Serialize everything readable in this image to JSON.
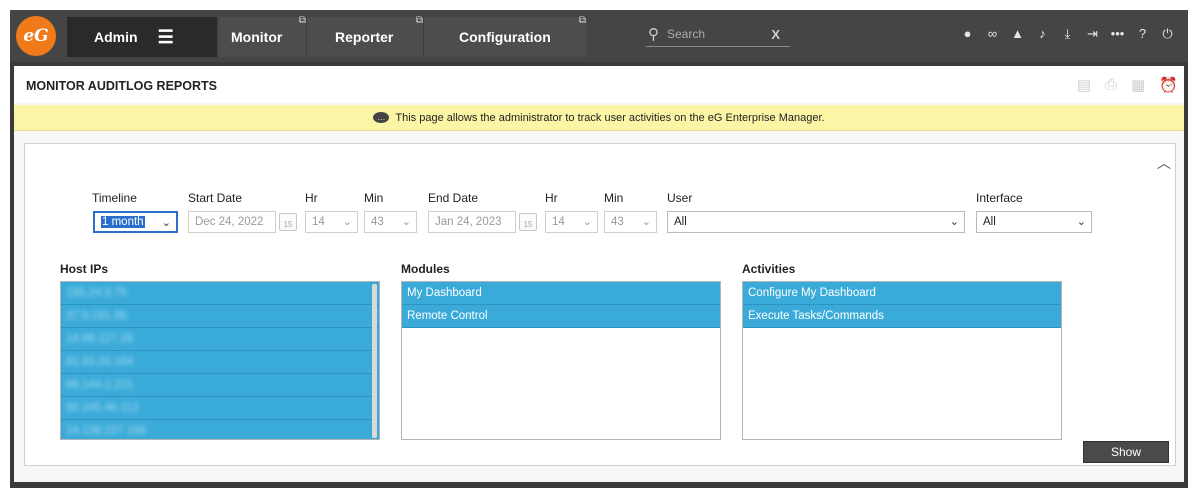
{
  "header": {
    "logo_text": "eG",
    "nav": [
      {
        "label": "Admin"
      },
      {
        "label": "Monitor"
      },
      {
        "label": "Reporter"
      },
      {
        "label": "Configuration"
      }
    ],
    "search": {
      "placeholder": "Search",
      "clear": "X"
    },
    "tool_icons": [
      "user-icon",
      "link-icon",
      "alert-icon",
      "bell-icon",
      "download-icon",
      "sign-in-icon",
      "more-icon",
      "help-icon",
      "power-icon"
    ],
    "colors": {
      "brand": "#f07a1a",
      "bar": "#454545"
    }
  },
  "page": {
    "title": "MONITOR AUDITLOG REPORTS",
    "info_text": "This page allows the administrator to track user activities on the eG Enterprise Manager."
  },
  "filters": {
    "timeline_label": "Timeline",
    "timeline_value": "1 month",
    "start_date_label": "Start Date",
    "start_date": "Dec 24, 2022",
    "calendar_day": "15",
    "hr_label": "Hr",
    "start_hr": "14",
    "min_label": "Min",
    "start_min": "43",
    "end_date_label": "End Date",
    "end_date": "Jan 24, 2023",
    "end_hr": "14",
    "end_min": "43",
    "user_label": "User",
    "user_value": "All",
    "interface_label": "Interface",
    "interface_value": "All"
  },
  "host_ips": {
    "label": "Host IPs",
    "items": [
      "185.24.9.76",
      "37.9.181.56",
      "14.99.127.26",
      "81.93.20.164",
      "86.144.2.221",
      "60.245.46.112",
      "24.138.227.189"
    ]
  },
  "modules": {
    "label": "Modules",
    "items": [
      "My Dashboard",
      "Remote Control"
    ]
  },
  "activities": {
    "label": "Activities",
    "items": [
      "Configure My Dashboard",
      "Execute Tasks/Commands"
    ]
  },
  "show_button": "Show",
  "accent_color": "#3aabd9"
}
